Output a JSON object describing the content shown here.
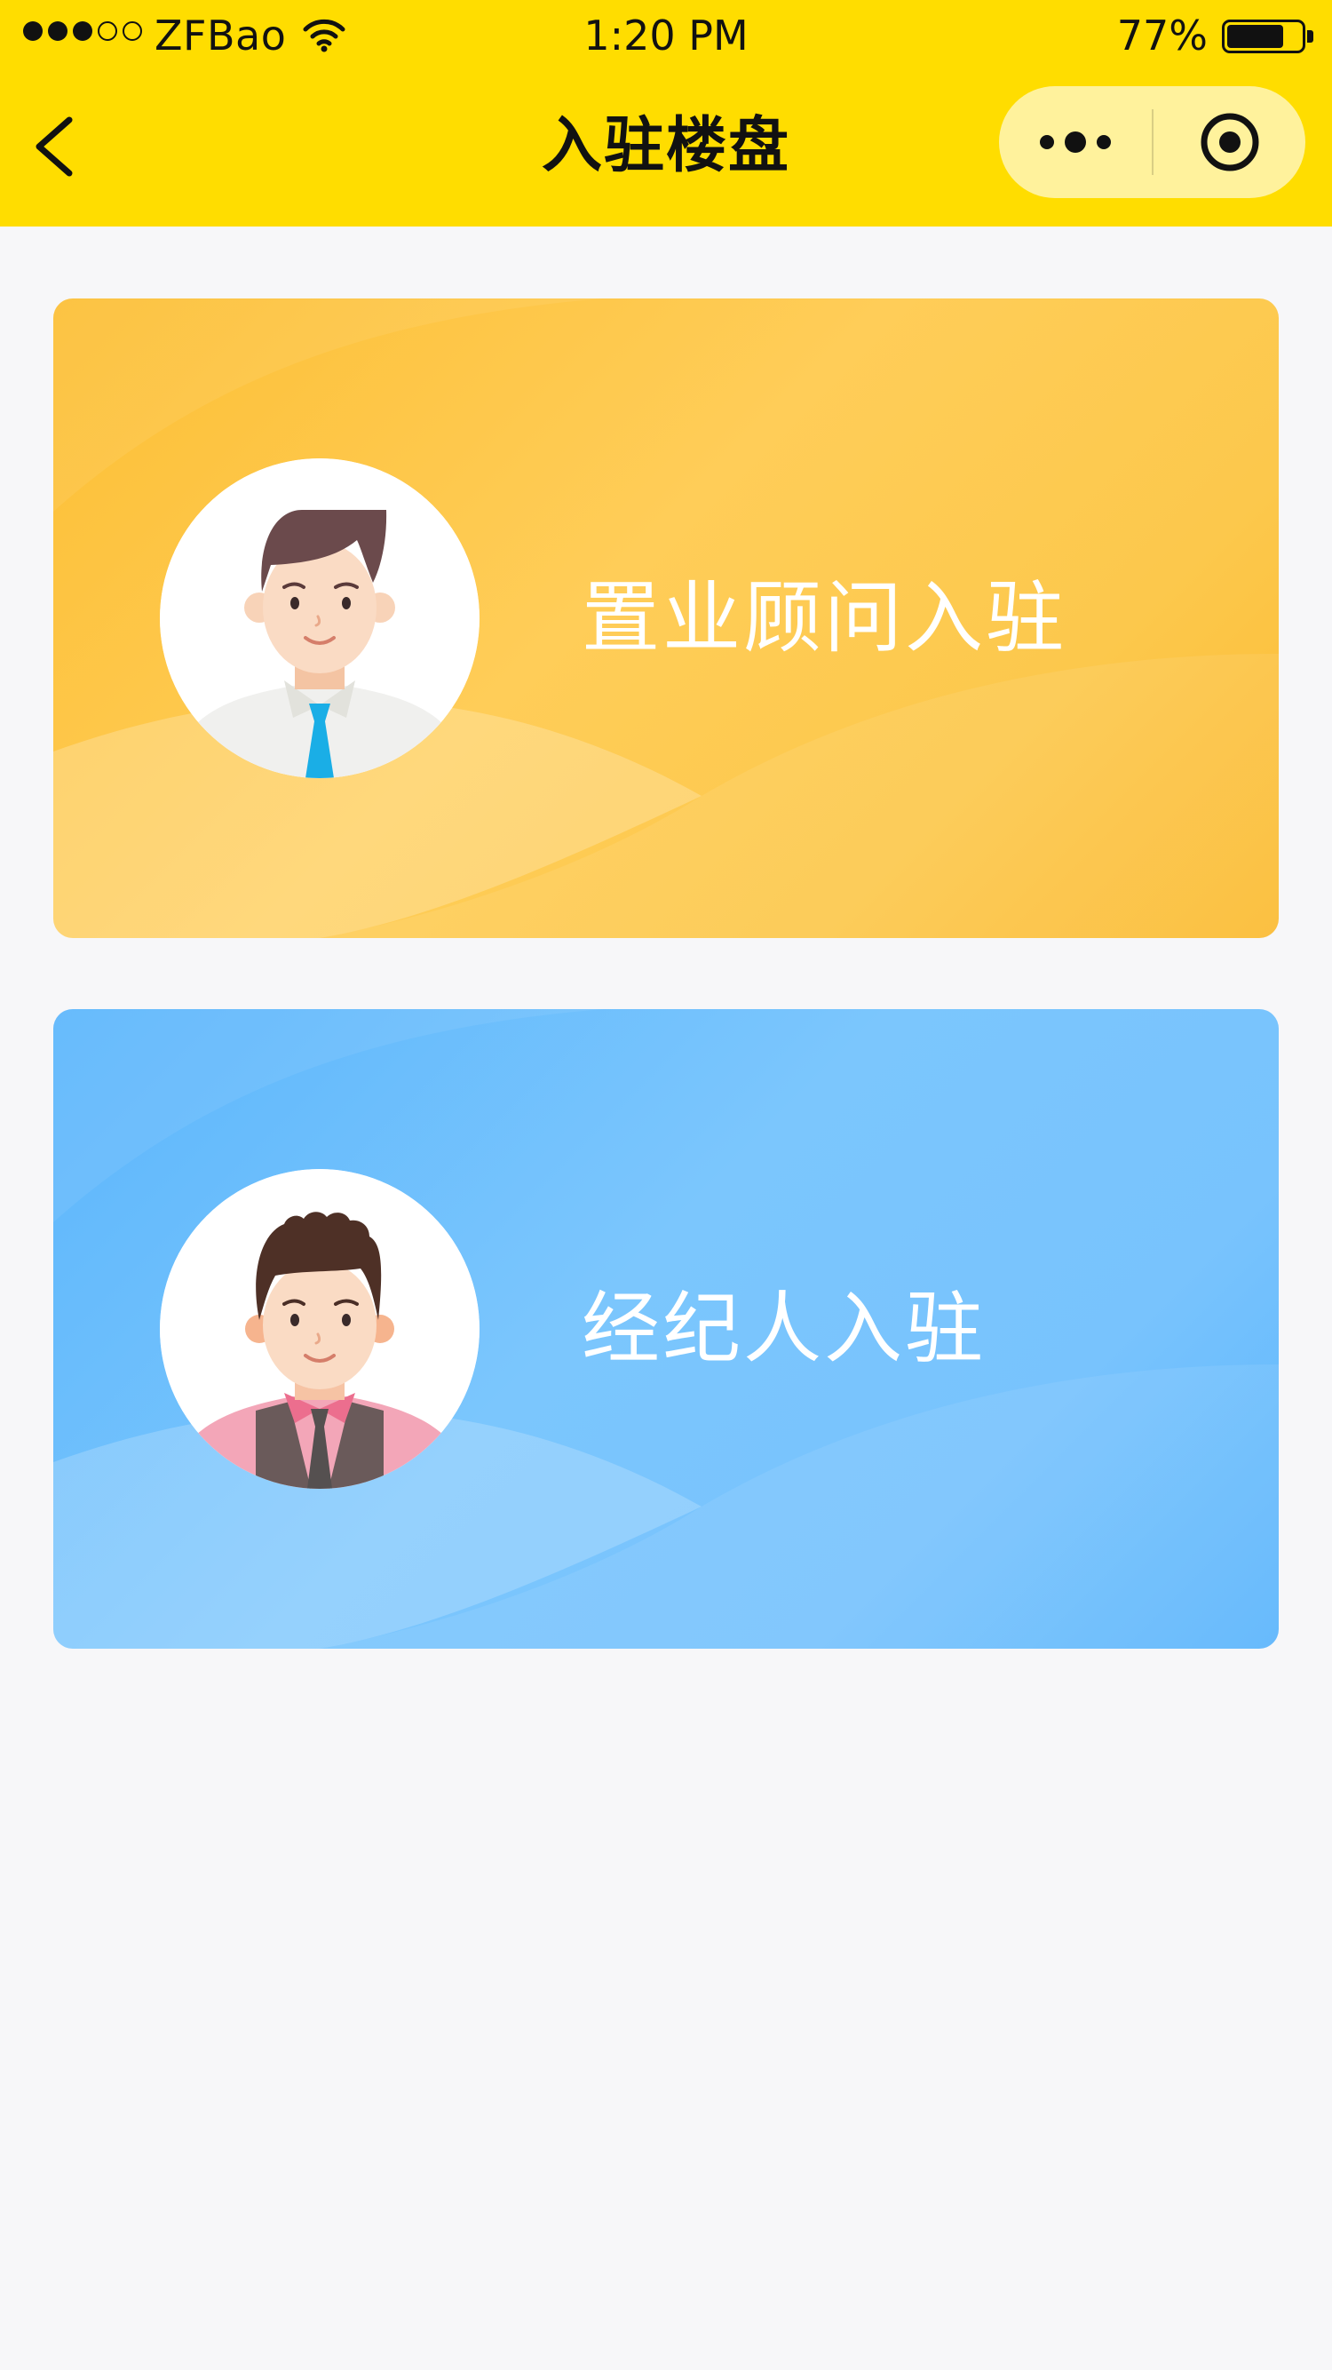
{
  "status_bar": {
    "carrier": "ZFBao",
    "time": "1:20 PM",
    "battery_percent": "77%",
    "battery_level": 0.77,
    "signal_bars_filled": 3,
    "signal_bars_total": 5
  },
  "nav": {
    "title": "入驻楼盘",
    "back_icon": "chevron-left-icon",
    "more_icon": "more-dots-icon",
    "close_icon": "target-circle-icon"
  },
  "colors": {
    "header_bg": "#ffdd00",
    "page_bg": "#f7f7f9",
    "consultant_card": "#fcc345",
    "agent_card": "#6dbefd"
  },
  "cards": [
    {
      "label": "置业顾问入驻",
      "avatar_icon": "consultant-avatar-icon"
    },
    {
      "label": "经纪人入驻",
      "avatar_icon": "agent-avatar-icon"
    }
  ]
}
